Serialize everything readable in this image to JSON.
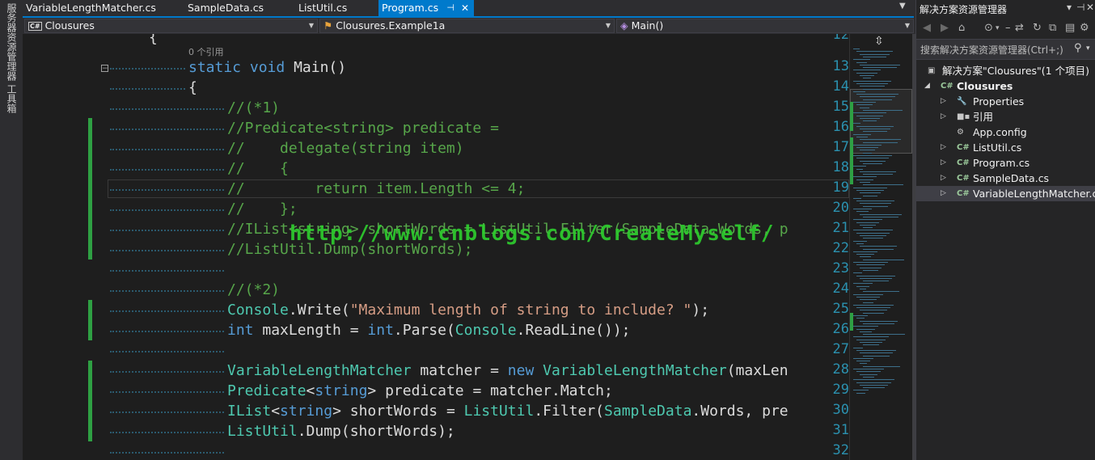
{
  "left_strip": {
    "server_explorer": "服务器资源管理器",
    "toolbox": "工具箱"
  },
  "tabs": [
    {
      "label": "VariableLengthMatcher.cs",
      "active": false
    },
    {
      "label": "SampleData.cs",
      "active": false
    },
    {
      "label": "ListUtil.cs",
      "active": false
    },
    {
      "label": "Program.cs",
      "active": true
    }
  ],
  "tab_close_glyph": "✕",
  "tab_pin_glyph": "⊣",
  "nav": {
    "project_icon": "C#",
    "project": "Clousures",
    "class": "Clousures.Example1a",
    "member": "Main()"
  },
  "editor": {
    "first_line_partial": "12",
    "reference_hint": "0 个引用",
    "lines": [
      {
        "n": "13",
        "tokens": [
          [
            "k",
            "static"
          ],
          [
            "p",
            " "
          ],
          [
            "k",
            "void"
          ],
          [
            "p",
            " Main()"
          ]
        ]
      },
      {
        "n": "14",
        "tokens": [
          [
            "p",
            "{"
          ]
        ]
      },
      {
        "n": "15",
        "tokens": [
          [
            "c",
            "//(*1)"
          ]
        ]
      },
      {
        "n": "16",
        "tokens": [
          [
            "c",
            "//Predicate<string> predicate ="
          ]
        ]
      },
      {
        "n": "17",
        "tokens": [
          [
            "c",
            "//    delegate(string item)"
          ]
        ]
      },
      {
        "n": "18",
        "tokens": [
          [
            "c",
            "//    {"
          ]
        ]
      },
      {
        "n": "19",
        "tokens": [
          [
            "c",
            "//        return item.Length <= 4;"
          ]
        ]
      },
      {
        "n": "20",
        "tokens": [
          [
            "c",
            "//    };"
          ]
        ]
      },
      {
        "n": "21",
        "tokens": [
          [
            "c",
            "//IList<string> shortWords = ListUtil.Filter(SampleData.Words, p"
          ]
        ]
      },
      {
        "n": "22",
        "tokens": [
          [
            "c",
            "//ListUtil.Dump(shortWords);"
          ]
        ]
      },
      {
        "n": "23",
        "tokens": []
      },
      {
        "n": "24",
        "tokens": [
          [
            "c",
            "//(*2)"
          ]
        ]
      },
      {
        "n": "25",
        "tokens": [
          [
            "t",
            "Console"
          ],
          [
            "p",
            ".Write("
          ],
          [
            "s",
            "\"Maximum length of string to include? \""
          ],
          [
            "p",
            ");"
          ]
        ]
      },
      {
        "n": "26",
        "tokens": [
          [
            "k",
            "int"
          ],
          [
            "p",
            " maxLength = "
          ],
          [
            "k",
            "int"
          ],
          [
            "p",
            ".Parse("
          ],
          [
            "t",
            "Console"
          ],
          [
            "p",
            ".ReadLine());"
          ]
        ]
      },
      {
        "n": "27",
        "tokens": []
      },
      {
        "n": "28",
        "tokens": [
          [
            "t",
            "VariableLengthMatcher"
          ],
          [
            "p",
            " matcher = "
          ],
          [
            "k",
            "new"
          ],
          [
            "p",
            " "
          ],
          [
            "t",
            "VariableLengthMatcher"
          ],
          [
            "p",
            "(maxLen"
          ]
        ]
      },
      {
        "n": "29",
        "tokens": [
          [
            "t",
            "Predicate"
          ],
          [
            "p",
            "<"
          ],
          [
            "k",
            "string"
          ],
          [
            "p",
            "> predicate = matcher.Match;"
          ]
        ]
      },
      {
        "n": "30",
        "tokens": [
          [
            "t",
            "IList"
          ],
          [
            "p",
            "<"
          ],
          [
            "k",
            "string"
          ],
          [
            "p",
            "> shortWords = "
          ],
          [
            "t",
            "ListUtil"
          ],
          [
            "p",
            ".Filter("
          ],
          [
            "t",
            "SampleData"
          ],
          [
            "p",
            ".Words, pre"
          ]
        ]
      },
      {
        "n": "31",
        "tokens": [
          [
            "t",
            "ListUtil"
          ],
          [
            "p",
            ".Dump(shortWords);"
          ]
        ]
      },
      {
        "n": "32",
        "tokens": []
      }
    ],
    "watermark": "http://www.cnblogs.com/CreateMyself/"
  },
  "solution_explorer": {
    "title": "解决方案资源管理器",
    "search_placeholder": "搜索解决方案资源管理器(Ctrl+;)",
    "solution_label": "解决方案\"Clousures\"(1 个项目)",
    "project": "Clousures",
    "items": [
      {
        "label": "Properties",
        "icon": "wrench-icon",
        "expander": true
      },
      {
        "label": "引用",
        "icon": "references-icon",
        "expander": true
      },
      {
        "label": "App.config",
        "icon": "config-icon",
        "expander": false
      },
      {
        "label": "ListUtil.cs",
        "icon": "csharp-file-icon",
        "expander": true
      },
      {
        "label": "Program.cs",
        "icon": "csharp-file-icon",
        "expander": true
      },
      {
        "label": "SampleData.cs",
        "icon": "csharp-file-icon",
        "expander": true
      },
      {
        "label": "VariableLengthMatcher.cs",
        "icon": "csharp-file-icon",
        "expander": true,
        "selected": true
      }
    ]
  },
  "colors": {
    "accent": "#007acc",
    "keyword": "#569cd6",
    "type": "#4ec9b0",
    "comment": "#57a64a",
    "string": "#d69d85",
    "line_number": "#2b91af",
    "change_marker": "#2ea043",
    "watermark": "#2ecc2e"
  }
}
